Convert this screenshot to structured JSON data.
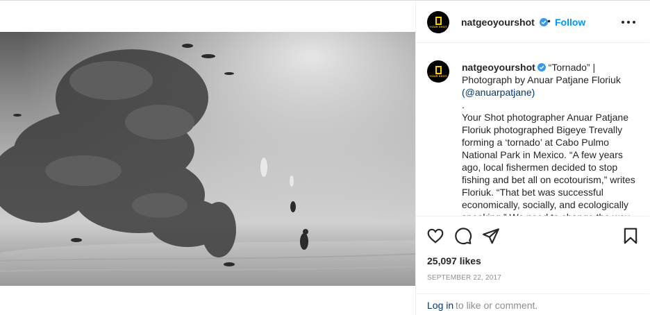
{
  "post": {
    "username": "natgeoyourshot",
    "follow_label": "Follow",
    "separator": "•",
    "avatar_logo_text": "YOUR SHOT",
    "caption": {
      "title": "“Tornado” | Photograph by Anuar Patjane Floriuk",
      "handle": "(@anuarpatjane)",
      "dot": ".",
      "body": "Your Shot photographer Anuar Patjane Floriuk photographed Bigeye Trevally forming a ‘tornado’ at Cabo Pulmo National Park in Mexico. “A few years ago, local fishermen decided to stop fishing and bet all on ecotourism,” writes Floriuk. “That bet was successful economically, socially, and ecologically speaking.” We need to change the way"
    },
    "likes": "25,097 likes",
    "date": "SEPTEMBER 22, 2017",
    "login_link": "Log in",
    "login_rest": "to like or comment."
  },
  "icons": {
    "verified": "verified-badge-icon",
    "more": "more-options-icon",
    "like": "heart-icon",
    "comment": "comment-icon",
    "share": "share-icon",
    "save": "bookmark-icon"
  },
  "colors": {
    "accent": "#0095f6",
    "link": "#00376b",
    "muted": "#8e8e8e",
    "logo": "#ffce00"
  }
}
